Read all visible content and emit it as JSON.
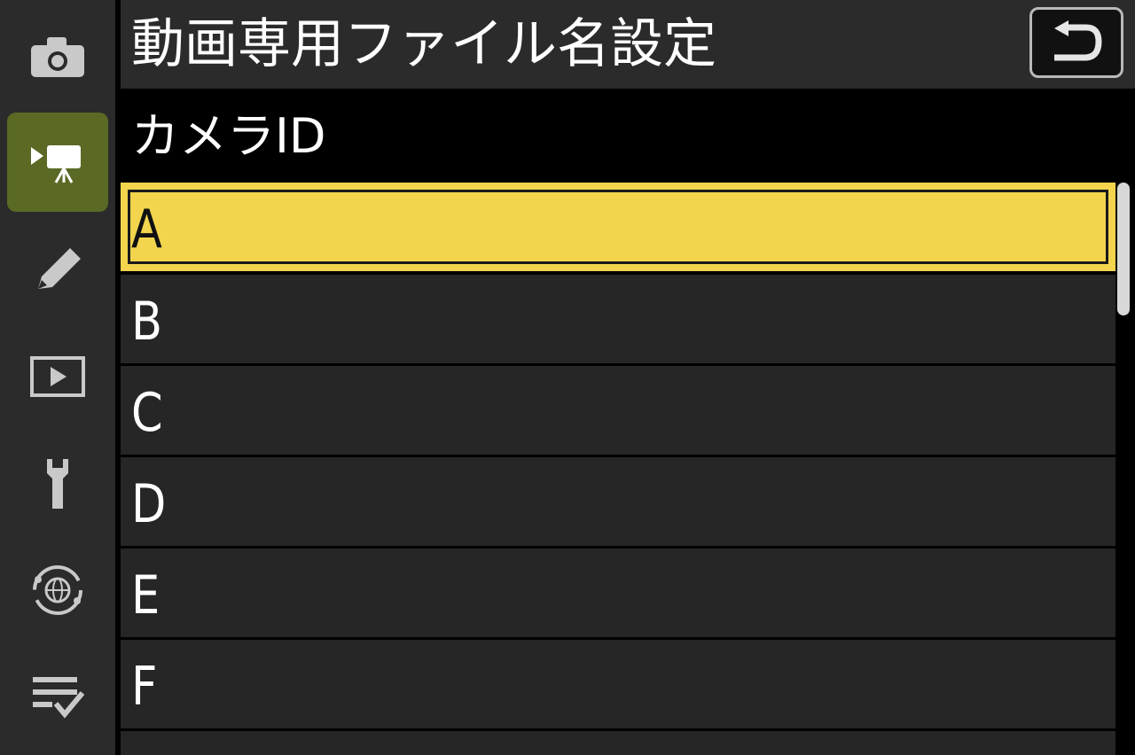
{
  "header": {
    "title": "動画専用ファイル名設定"
  },
  "section": {
    "label": "カメラID"
  },
  "list": {
    "items": [
      "A",
      "B",
      "C",
      "D",
      "E",
      "F"
    ],
    "selected_index": 0
  },
  "sidebar": {
    "items": [
      {
        "icon": "camera-icon"
      },
      {
        "icon": "movie-camera-icon",
        "active": true
      },
      {
        "icon": "pencil-icon"
      },
      {
        "icon": "playback-icon"
      },
      {
        "icon": "wrench-icon"
      },
      {
        "icon": "network-icon"
      },
      {
        "icon": "my-menu-icon"
      }
    ]
  },
  "colors": {
    "selected_bg": "#f2d44d",
    "active_tab_bg": "#5a6a25"
  }
}
